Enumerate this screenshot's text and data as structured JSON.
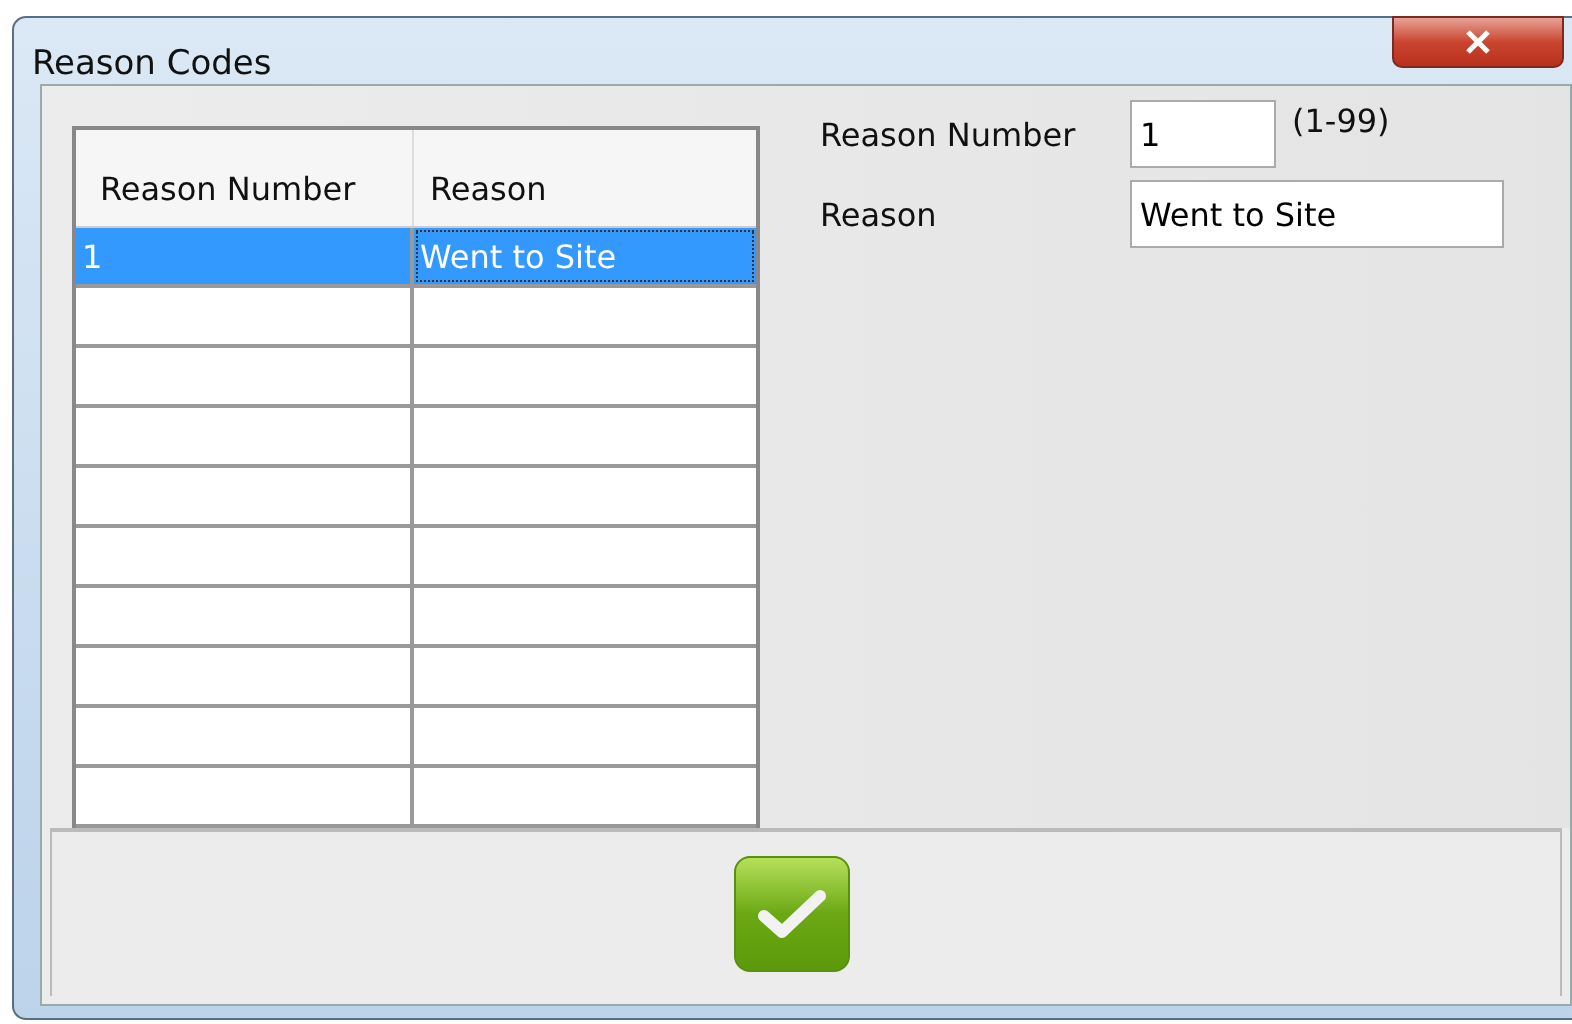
{
  "window": {
    "title": "Reason Codes"
  },
  "table": {
    "columns": [
      "Reason Number",
      "Reason"
    ],
    "rows": [
      {
        "cells": [
          "1",
          "Went to Site"
        ],
        "selected": true
      }
    ]
  },
  "form": {
    "fields": [
      {
        "label": "Reason Number",
        "value": "1",
        "hint": "(1-99)",
        "kind": "short"
      },
      {
        "label": "Reason",
        "value": "Went to Site",
        "kind": "long"
      }
    ]
  }
}
